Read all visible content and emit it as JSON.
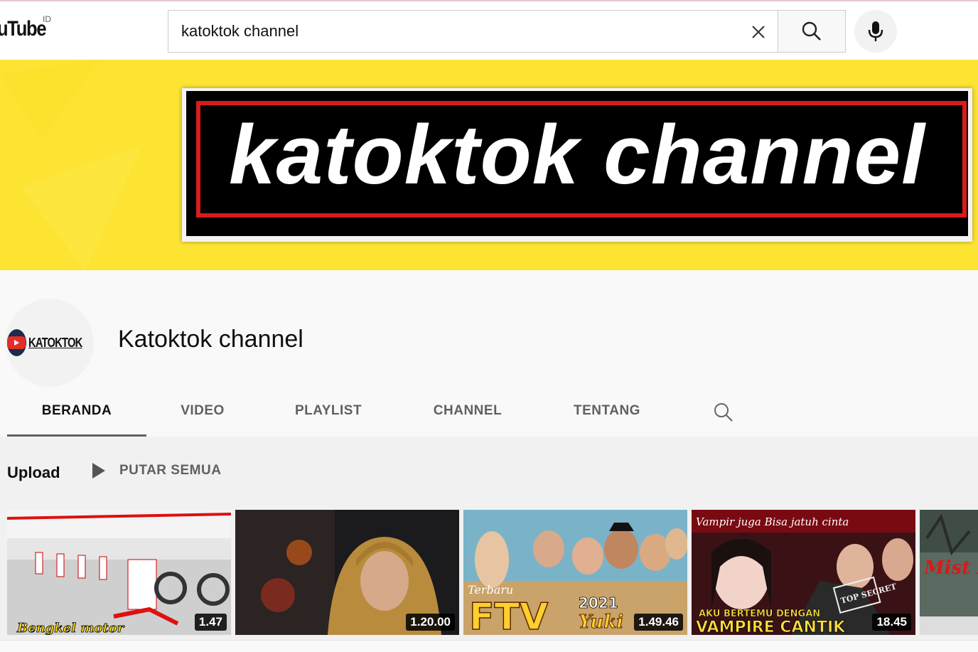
{
  "header": {
    "logo_text": "uTube",
    "region": "ID",
    "search_value": "katoktok channel"
  },
  "banner": {
    "text": "katoktok channel"
  },
  "channel": {
    "avatar_text": "KATOKTOK",
    "name": "Katoktok channel"
  },
  "tabs": [
    {
      "label": "BERANDA",
      "active": true
    },
    {
      "label": "VIDEO"
    },
    {
      "label": "PLAYLIST"
    },
    {
      "label": "CHANNEL"
    },
    {
      "label": "TENTANG"
    }
  ],
  "uploads": {
    "title": "Upload",
    "play_all_label": "PUTAR SEMUA",
    "videos": [
      {
        "duration": "1.47",
        "caption": "Bengkel motor"
      },
      {
        "duration": "1.20.00"
      },
      {
        "duration": "1.49.46",
        "caption_top": "Terbaru",
        "caption_main": "FTV",
        "caption_year": "2021",
        "caption_name": "Yuki"
      },
      {
        "duration": "18.45",
        "caption_top": "Vampir juga Bisa jatuh cinta",
        "caption_line1": "AKU BERTEMU DENGAN",
        "caption_line2": "VAMPIRE CANTIK",
        "stamp": "TOP SECRET"
      },
      {
        "caption": "Mist KK"
      }
    ]
  },
  "colors": {
    "banner_yellow": "#fde433",
    "banner_red": "#d81b1b",
    "brand_red": "#e52d27"
  }
}
